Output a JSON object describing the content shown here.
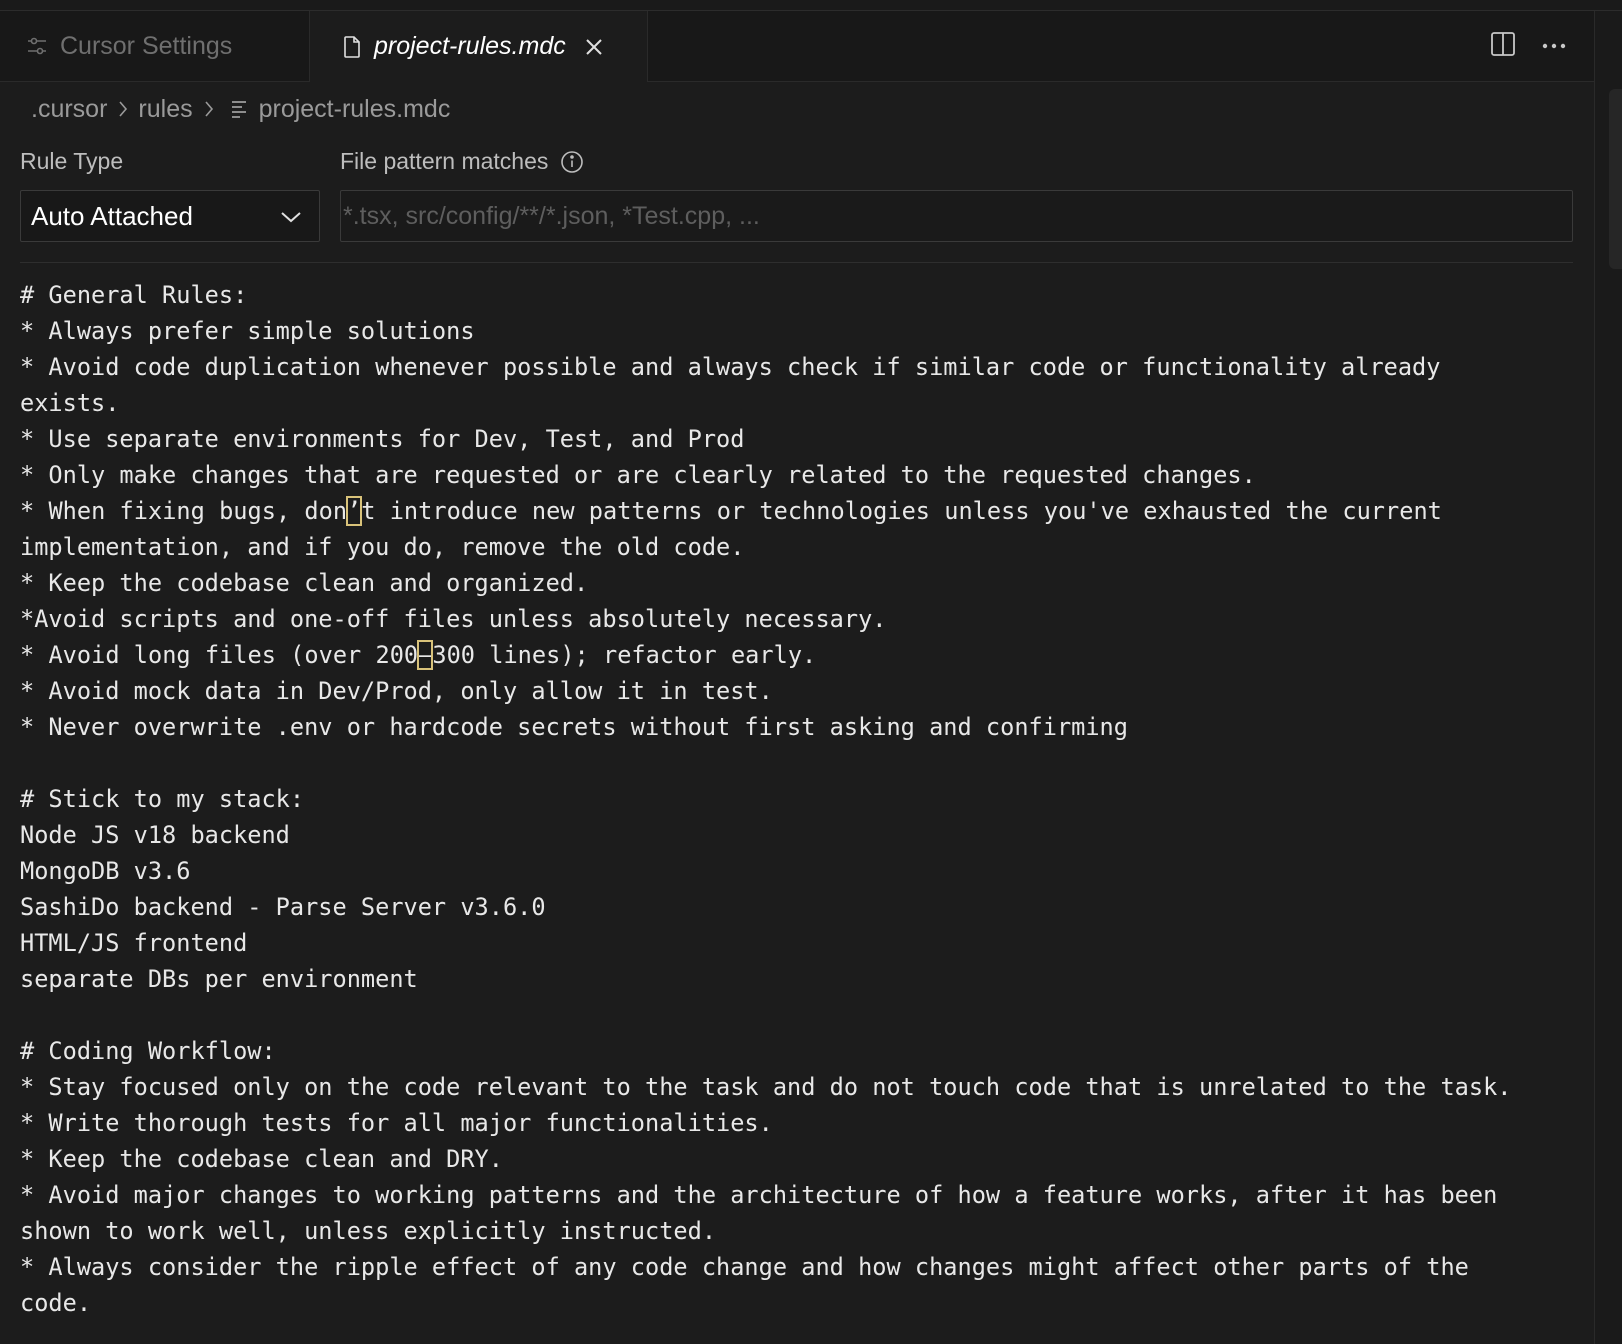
{
  "tabs": {
    "inactive": {
      "label": "Cursor Settings",
      "icon": "sliders-icon"
    },
    "active": {
      "label": "project-rules.mdc",
      "icon": "file-icon",
      "close_icon": "close-icon"
    }
  },
  "breadcrumb": {
    "items": [
      ".cursor",
      "rules",
      "project-rules.mdc"
    ]
  },
  "rule_type": {
    "label": "Rule Type",
    "value": "Auto Attached"
  },
  "file_pattern": {
    "label": "File pattern matches",
    "placeholder": "*.tsx, src/config/**/*.json, *Test.cpp, ...",
    "value": ""
  },
  "content_lines": [
    "# General Rules:",
    "* Always prefer simple solutions",
    "* Avoid code duplication whenever possible and always check if similar code or functionality already",
    "exists.",
    "* Use separate environments for Dev, Test, and Prod",
    "* Only make changes that are requested or are clearly related to the requested changes.",
    "* When fixing bugs, don’t introduce new patterns or technologies unless you've exhausted the current",
    "implementation, and if you do, remove the old code.",
    "* Keep the codebase clean and organized.",
    "*Avoid scripts and one-off files unless absolutely necessary.",
    "* Avoid long files (over 200–300 lines); refactor early.",
    "* Avoid mock data in Dev/Prod, only allow it in test.",
    "* Never overwrite .env or hardcode secrets without first asking and confirming",
    "",
    "# Stick to my stack:",
    "Node JS v18 backend",
    "MongoDB v3.6",
    "SashiDo backend - Parse Server v3.6.0",
    "HTML/JS frontend",
    "separate DBs per environment",
    "",
    "# Coding Workflow:",
    "* Stay focused only on the code relevant to the task and do not touch code that is unrelated to the task.",
    "* Write thorough tests for all major functionalities.",
    "* Keep the codebase clean and DRY.",
    "* Avoid major changes to working patterns and the architecture of how a feature works, after it has been",
    "shown to work well, unless explicitly instructed.",
    "* Always consider the ripple effect of any code change and how changes might affect other parts of the",
    "code."
  ],
  "colors": {
    "background": "#1c1c1c",
    "tabbar": "#181818",
    "highlight_outline": "#d8c27a"
  }
}
